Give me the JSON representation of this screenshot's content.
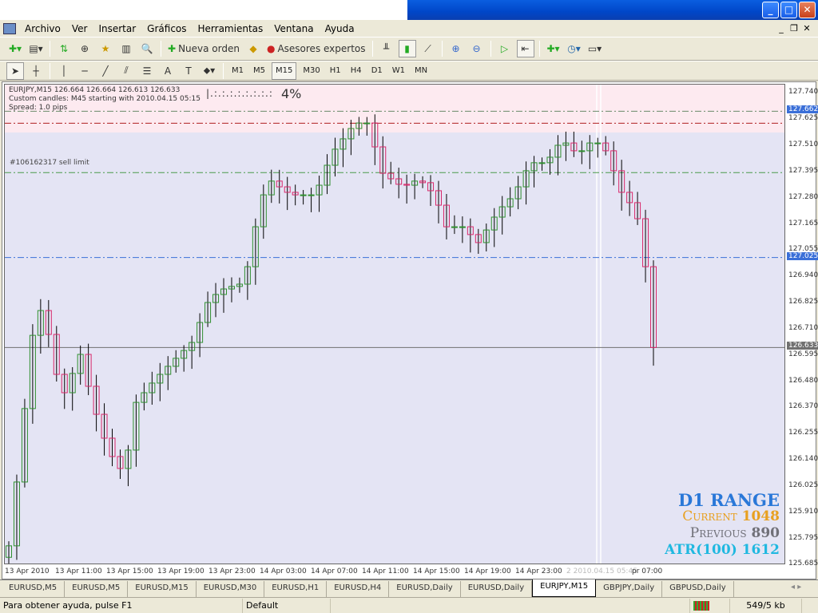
{
  "window": {
    "buttons": [
      "_",
      "□",
      "✕"
    ]
  },
  "menu": [
    "Archivo",
    "Ver",
    "Insertar",
    "Gráficos",
    "Herramientas",
    "Ventana",
    "Ayuda"
  ],
  "mdi": [
    "_",
    "❐",
    "✕"
  ],
  "toolbar1": {
    "new_order": "Nueva orden",
    "experts": "Asesores expertos"
  },
  "timeframes": [
    "M1",
    "M5",
    "M15",
    "M30",
    "H1",
    "H4",
    "D1",
    "W1",
    "MN"
  ],
  "active_timeframe": "M15",
  "chart": {
    "header": "EURJPY,M15  126.664 126.664 126.613 126.633",
    "custom": "Custom candles: M45 starting with 2010.04.15 05:15",
    "spread": "Spread: 1.0 pips",
    "progress_dots": "|.:.:.:.:.:.:.:.:",
    "progress": "4%",
    "sell_limit": "#106162317 sell limit",
    "d1": {
      "title": "D1 RANGE",
      "current_label": "Current",
      "current": "1048",
      "previous_label": "Previous",
      "previous": "890",
      "atr_label": "ATR(100)",
      "atr": "1612"
    },
    "colors": {
      "bg": "#e4e4f4",
      "bull": "#2f8f2f",
      "bear": "#d8286a",
      "wick": "#000000",
      "band": "#fdeaf0"
    }
  },
  "chart_data": {
    "type": "candlestick",
    "symbol": "EURJPY,M15",
    "ylim": [
      125.685,
      127.74
    ],
    "yticks": [
      "127.740",
      "127.625",
      "127.510",
      "127.395",
      "127.280",
      "127.165",
      "127.055",
      "126.940",
      "126.825",
      "126.710",
      "126.595",
      "126.480",
      "126.370",
      "126.255",
      "126.140",
      "126.025",
      "125.910",
      "125.795",
      "125.685"
    ],
    "xticks": [
      "13 Apr 2010",
      "13 Apr 11:00",
      "13 Apr 15:00",
      "13 Apr 19:00",
      "13 Apr 23:00",
      "14 Apr 03:00",
      "14 Apr 07:00",
      "14 Apr 11:00",
      "14 Apr 15:00",
      "14 Apr 19:00",
      "14 Apr 23:00",
      "2 2010.04.15 05:45",
      "pr 07:00"
    ],
    "levels": [
      {
        "price": 127.662,
        "label": "127.662",
        "style": "dashdot",
        "color": "#6a8a6a",
        "box": "#3a6fd8"
      },
      {
        "price": 127.61,
        "style": "dashdot",
        "color": "#b02020"
      },
      {
        "price": 127.395,
        "style": "dashdot",
        "color": "#4a9a4a"
      },
      {
        "price": 127.025,
        "label": "127.025",
        "style": "dashdot",
        "color": "#3a6fd8",
        "box": "#3a6fd8"
      },
      {
        "price": 126.633,
        "label": "126.633",
        "style": "solid",
        "color": "#707070",
        "box": "#707070"
      }
    ],
    "closes": [
      125.769,
      126.047,
      126.367,
      126.686,
      126.794,
      126.69,
      126.516,
      126.436,
      126.52,
      126.603,
      126.464,
      126.342,
      126.238,
      126.158,
      126.106,
      126.186,
      126.394,
      126.436,
      126.478,
      126.516,
      126.551,
      126.586,
      126.62,
      126.655,
      126.742,
      126.829,
      126.864,
      126.888,
      126.899,
      126.909,
      126.985,
      127.159,
      127.298,
      127.358,
      127.333,
      127.309,
      127.298,
      127.298,
      127.298,
      127.34,
      127.427,
      127.497,
      127.542,
      127.587,
      127.611,
      127.611,
      127.507,
      127.392,
      127.368,
      127.344,
      127.34,
      127.358,
      127.351,
      127.316,
      127.253,
      127.159,
      127.159,
      127.159,
      127.125,
      127.09,
      127.145,
      127.201,
      127.246,
      127.281,
      127.333,
      127.403,
      127.438,
      127.438,
      127.462,
      127.514,
      127.524,
      127.49,
      127.49,
      127.524,
      127.524,
      127.49,
      127.403,
      127.309,
      127.264,
      127.194,
      126.985,
      126.633
    ]
  },
  "tabs": [
    "EURUSD,M5",
    "EURUSD,M5",
    "EURUSD,M15",
    "EURUSD,M30",
    "EURUSD,H1",
    "EURUSD,H4",
    "EURUSD,Daily",
    "EURUSD,Daily",
    "EURJPY,M15",
    "GBPJPY,Daily",
    "GBPUSD,Daily"
  ],
  "active_tab": 8,
  "status": {
    "help": "Para obtener ayuda, pulse F1",
    "profile": "Default",
    "traffic": "549/5 kb"
  }
}
